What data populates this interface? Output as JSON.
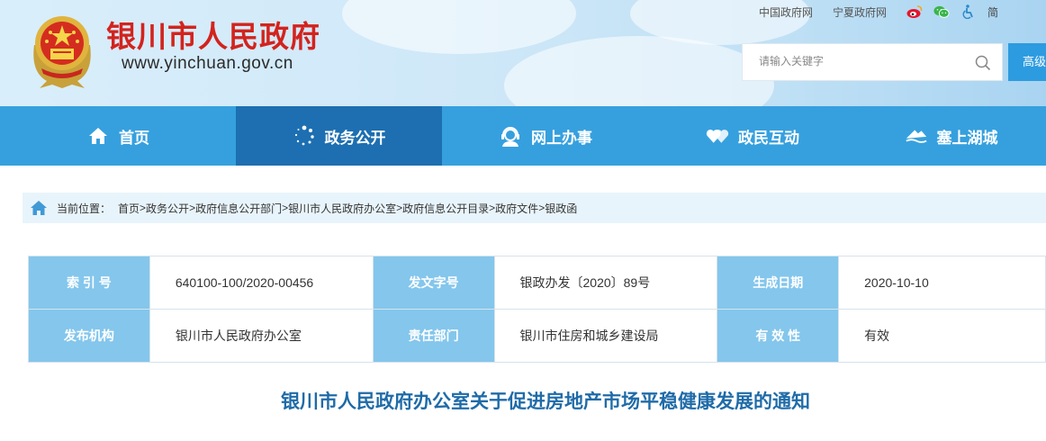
{
  "header": {
    "site_name": "银川市人民政府",
    "site_url": "www.yinchuan.gov.cn",
    "links": [
      "中国政府网",
      "宁夏政府网"
    ],
    "icons": [
      "weibo-icon",
      "wechat-icon",
      "accessibility-icon"
    ],
    "lang_label": "简"
  },
  "search": {
    "placeholder": "请输入关键字",
    "advanced_label": "高级"
  },
  "nav": {
    "items": [
      {
        "label": "首页",
        "icon": "home-icon"
      },
      {
        "label": "政务公开",
        "icon": "dots-circle-icon"
      },
      {
        "label": "网上办事",
        "icon": "service-person-icon"
      },
      {
        "label": "政民互动",
        "icon": "hearts-icon"
      },
      {
        "label": "塞上湖城",
        "icon": "landscape-icon"
      }
    ],
    "active_index": 1
  },
  "breadcrumb": {
    "prefix": "当前位置：",
    "items": [
      "首页",
      "政务公开",
      "政府信息公开部门",
      "银川市人民政府办公室",
      "政府信息公开目录",
      "政府文件",
      "银政函"
    ]
  },
  "meta": {
    "rows": [
      [
        {
          "key": "索 引 号",
          "value": "640100-100/2020-00456"
        },
        {
          "key": "发文字号",
          "value": "银政办发〔2020〕89号"
        },
        {
          "key": "生成日期",
          "value": "2020-10-10"
        }
      ],
      [
        {
          "key": "发布机构",
          "value": "银川市人民政府办公室"
        },
        {
          "key": "责任部门",
          "value": "银川市住房和城乡建设局"
        },
        {
          "key": "有 效 性",
          "value": "有效"
        }
      ]
    ]
  },
  "document": {
    "title": "银川市人民政府办公室关于促进房地产市场平稳健康发展的通知"
  },
  "colors": {
    "brand_red": "#d3231e",
    "nav_blue": "#36a0de",
    "nav_active": "#1d6fb1",
    "key_cell": "#84c6ec",
    "title_blue": "#1f6ba8"
  }
}
